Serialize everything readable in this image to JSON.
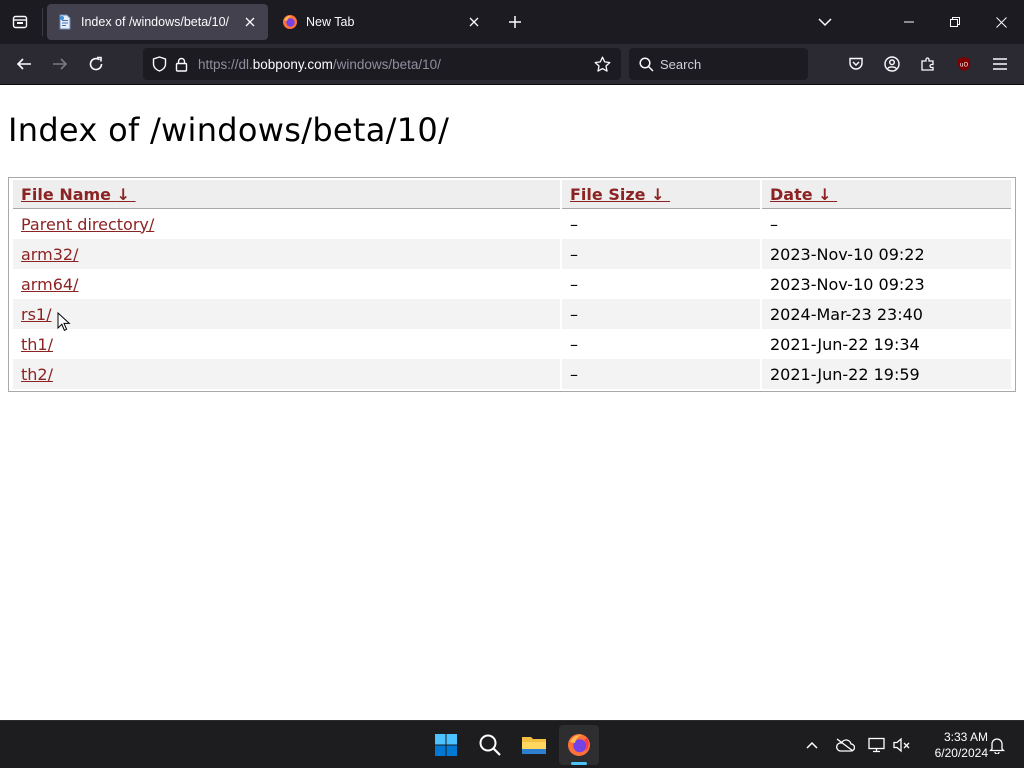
{
  "browser": {
    "tabs": [
      {
        "title": "Index of /windows/beta/10/",
        "active": true,
        "icon": "document-favicon"
      },
      {
        "title": "New Tab",
        "active": false,
        "icon": "firefox-favicon"
      }
    ],
    "url_prefix": "https://dl.",
    "url_host": "bobpony.com",
    "url_path": "/windows/beta/10/",
    "search_placeholder": "Search",
    "colors": {
      "tabbar": "#1c1b22",
      "navbar": "#2b2a33",
      "active_tab": "#42414d"
    }
  },
  "page": {
    "title": "Index of /windows/beta/10/",
    "columns": [
      {
        "label": "File Name",
        "sort_arrow": "↓"
      },
      {
        "label": "File Size",
        "sort_arrow": "↓"
      },
      {
        "label": "Date",
        "sort_arrow": "↓"
      }
    ],
    "rows": [
      {
        "name": "Parent directory/",
        "size": "–",
        "date": "–"
      },
      {
        "name": "arm32/",
        "size": "–",
        "date": "2023-Nov-10 09:22"
      },
      {
        "name": "arm64/",
        "size": "–",
        "date": "2023-Nov-10 09:23"
      },
      {
        "name": "rs1/",
        "size": "–",
        "date": "2024-Mar-23 23:40"
      },
      {
        "name": "th1/",
        "size": "–",
        "date": "2021-Jun-22 19:34"
      },
      {
        "name": "th2/",
        "size": "–",
        "date": "2021-Jun-22 19:59"
      }
    ],
    "link_color": "#8b2323"
  },
  "taskbar": {
    "time": "3:33 AM",
    "date": "6/20/2024",
    "pinned": [
      "windows-start-icon",
      "search-icon",
      "file-explorer-icon",
      "firefox-icon"
    ],
    "tray": [
      "chevron-up-icon",
      "onedrive-icon",
      "network-icon",
      "volume-muted-icon",
      "notification-bell-icon"
    ]
  }
}
